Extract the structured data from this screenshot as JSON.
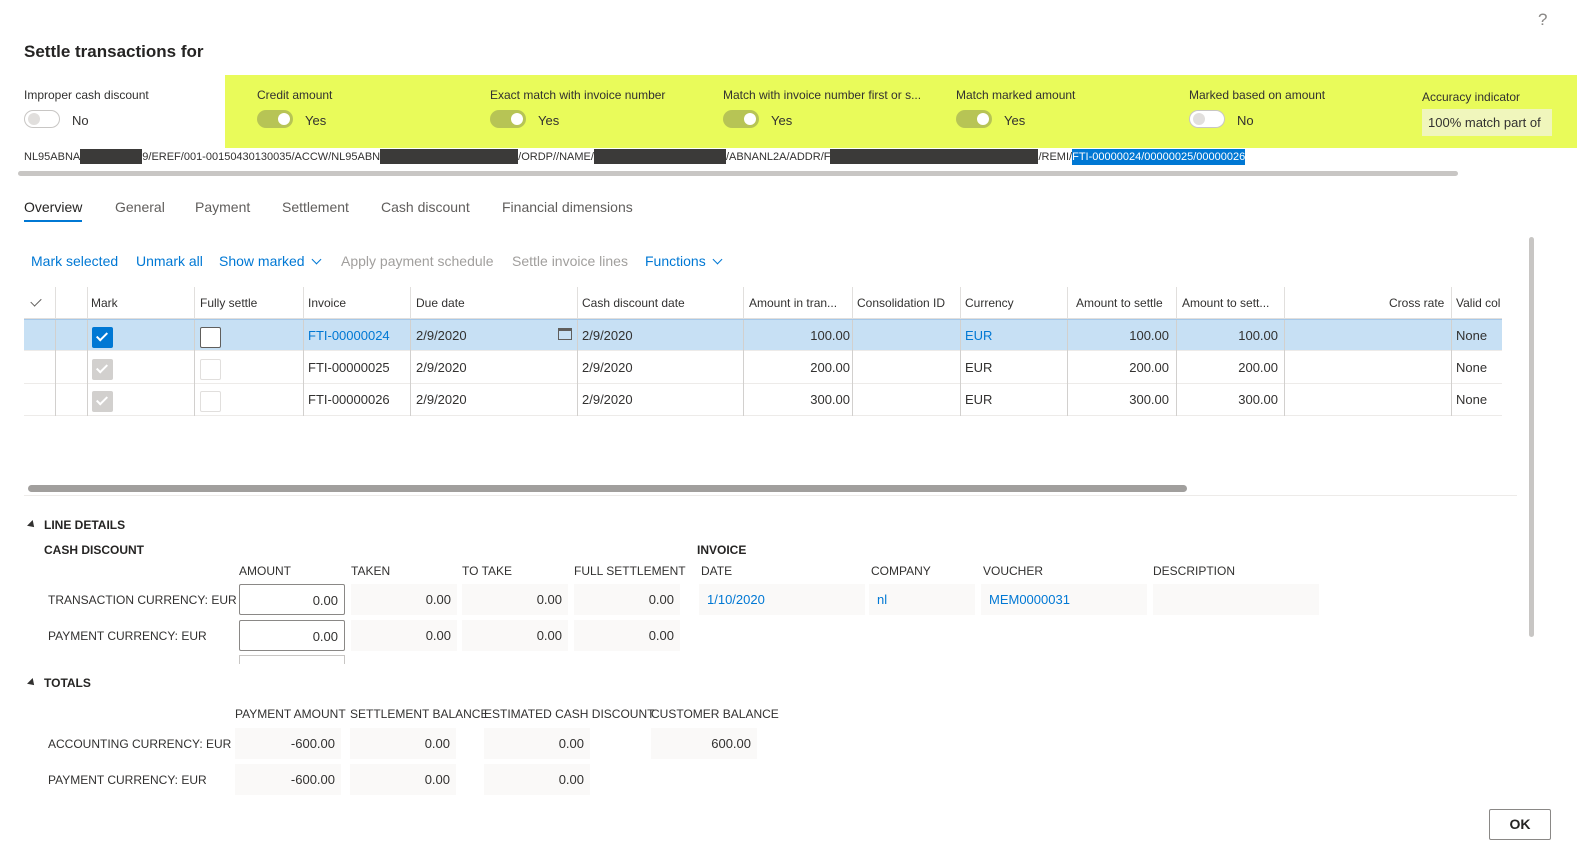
{
  "help_glyph": "?",
  "title": "Settle transactions for",
  "toggles": [
    {
      "label": "Improper cash discount",
      "value": "No",
      "on": false
    },
    {
      "label": "Credit amount",
      "value": "Yes",
      "on": true
    },
    {
      "label": "Exact match with invoice number",
      "value": "Yes",
      "on": true
    },
    {
      "label": "Match with invoice number first or s...",
      "value": "Yes",
      "on": true
    },
    {
      "label": "Match marked amount",
      "value": "Yes",
      "on": true
    },
    {
      "label": "Marked based on amount",
      "value": "No",
      "on": false
    }
  ],
  "accuracy": {
    "label": "Accuracy indicator",
    "value": "100% match part of"
  },
  "payment_text": {
    "p1": "NL95ABNA",
    "p2": "9/EREF/001-00150430130035/ACCW/NL95ABN",
    "p3": "/ORDP//NAME/",
    "p4": "/ABNANL2A/ADDR/F",
    "p5": "/REMI/",
    "p6": "FTI-00000024/00000025/00000026"
  },
  "tabs": [
    "Overview",
    "General",
    "Payment",
    "Settlement",
    "Cash discount",
    "Financial dimensions"
  ],
  "actions": {
    "mark_selected": "Mark selected",
    "unmark_all": "Unmark all",
    "show_marked": "Show marked",
    "apply_payment_schedule": "Apply payment schedule",
    "settle_invoice_lines": "Settle invoice lines",
    "functions": "Functions"
  },
  "grid": {
    "columns": [
      "Mark",
      "Fully settle",
      "Invoice",
      "Due date",
      "Cash discount date",
      "Amount in tran...",
      "Consolidation ID",
      "Currency",
      "Amount to settle",
      "Amount to sett...",
      "Cross rate",
      "Valid col"
    ],
    "rows": [
      {
        "invoice": "FTI-00000024",
        "due_date": "2/9/2020",
        "cash_discount_date": "2/9/2020",
        "amount": "100.00",
        "consolidation": "",
        "currency": "EUR",
        "amount_to_settle": "100.00",
        "amount_to_settle2": "100.00",
        "cross_rate": "",
        "valid": "None"
      },
      {
        "invoice": "FTI-00000025",
        "due_date": "2/9/2020",
        "cash_discount_date": "2/9/2020",
        "amount": "200.00",
        "consolidation": "",
        "currency": "EUR",
        "amount_to_settle": "200.00",
        "amount_to_settle2": "200.00",
        "cross_rate": "",
        "valid": "None"
      },
      {
        "invoice": "FTI-00000026",
        "due_date": "2/9/2020",
        "cash_discount_date": "2/9/2020",
        "amount": "300.00",
        "consolidation": "",
        "currency": "EUR",
        "amount_to_settle": "300.00",
        "amount_to_settle2": "300.00",
        "cross_rate": "",
        "valid": "None"
      }
    ]
  },
  "line_details": {
    "section_title": "LINE DETAILS",
    "cash_discount_title": "CASH DISCOUNT",
    "col_amount": "AMOUNT",
    "col_taken": "TAKEN",
    "col_to_take": "TO TAKE",
    "col_full_settlement": "FULL SETTLEMENT",
    "row1_label": "TRANSACTION CURRENCY: EUR",
    "row1": {
      "amount": "0.00",
      "taken": "0.00",
      "to_take": "0.00",
      "full": "0.00"
    },
    "row2_label": "PAYMENT CURRENCY: EUR",
    "row2": {
      "amount": "0.00",
      "taken": "0.00",
      "to_take": "0.00",
      "full": "0.00"
    },
    "invoice_title": "INVOICE",
    "col_date": "DATE",
    "col_company": "COMPANY",
    "col_voucher": "VOUCHER",
    "col_description": "DESCRIPTION",
    "invoice_values": {
      "date": "1/10/2020",
      "company": "nl",
      "voucher": "MEM0000031",
      "description": ""
    }
  },
  "totals": {
    "section_title": "TOTALS",
    "col_payment_amount": "PAYMENT AMOUNT",
    "col_settlement_balance": "SETTLEMENT BALANCE",
    "col_estimated_cash_discount": "ESTIMATED CASH DISCOUNT",
    "col_customer_balance": "CUSTOMER BALANCE",
    "row1_label": "ACCOUNTING CURRENCY: EUR",
    "row1": {
      "payment": "-600.00",
      "settlement": "0.00",
      "discount": "0.00",
      "customer": "600.00"
    },
    "row2_label": "PAYMENT CURRENCY: EUR",
    "row2": {
      "payment": "-600.00",
      "settlement": "0.00",
      "discount": "0.00"
    }
  },
  "ok_label": "OK"
}
